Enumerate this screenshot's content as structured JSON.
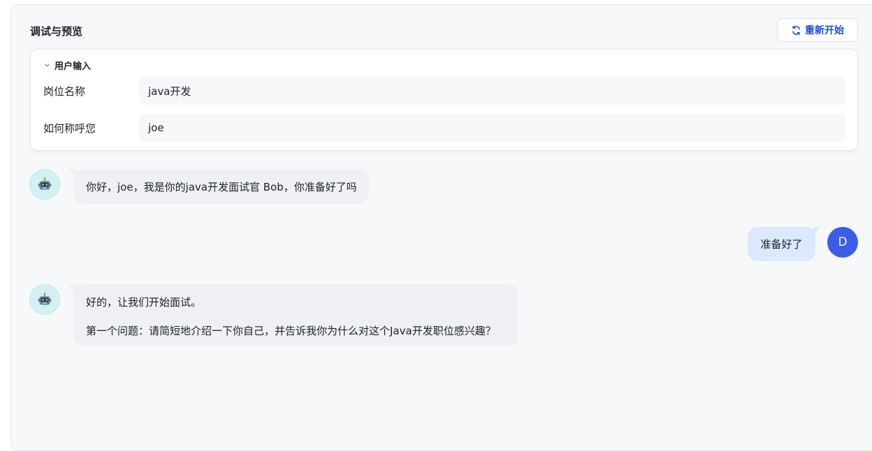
{
  "panel": {
    "title": "调试与预览",
    "restart_label": "重新开始"
  },
  "user_input": {
    "header": "用户输入",
    "fields": [
      {
        "label": "岗位名称",
        "value": "java开发"
      },
      {
        "label": "如何称呼您",
        "value": "joe"
      }
    ]
  },
  "messages": [
    {
      "role": "bot",
      "lines": [
        "你好，joe，我是你的java开发面试官 Bob，你准备好了吗"
      ]
    },
    {
      "role": "user",
      "avatar_letter": "D",
      "lines": [
        "准备好了"
      ]
    },
    {
      "role": "bot",
      "lines": [
        "好的，让我们开始面试。",
        "第一个问题：请简短地介绍一下你自己，并告诉我你为什么对这个Java开发职位感兴趣？"
      ]
    }
  ],
  "colors": {
    "accent": "#1c4fd8",
    "user_avatar": "#3b5de7",
    "user_bubble": "#dbe8fd",
    "bot_bubble": "#eef0f3",
    "bot_avatar": "#d3f1f3"
  },
  "icons": {
    "restart": "refresh-icon",
    "collapse": "chevron-down-icon",
    "bot_avatar": "robot-icon"
  }
}
